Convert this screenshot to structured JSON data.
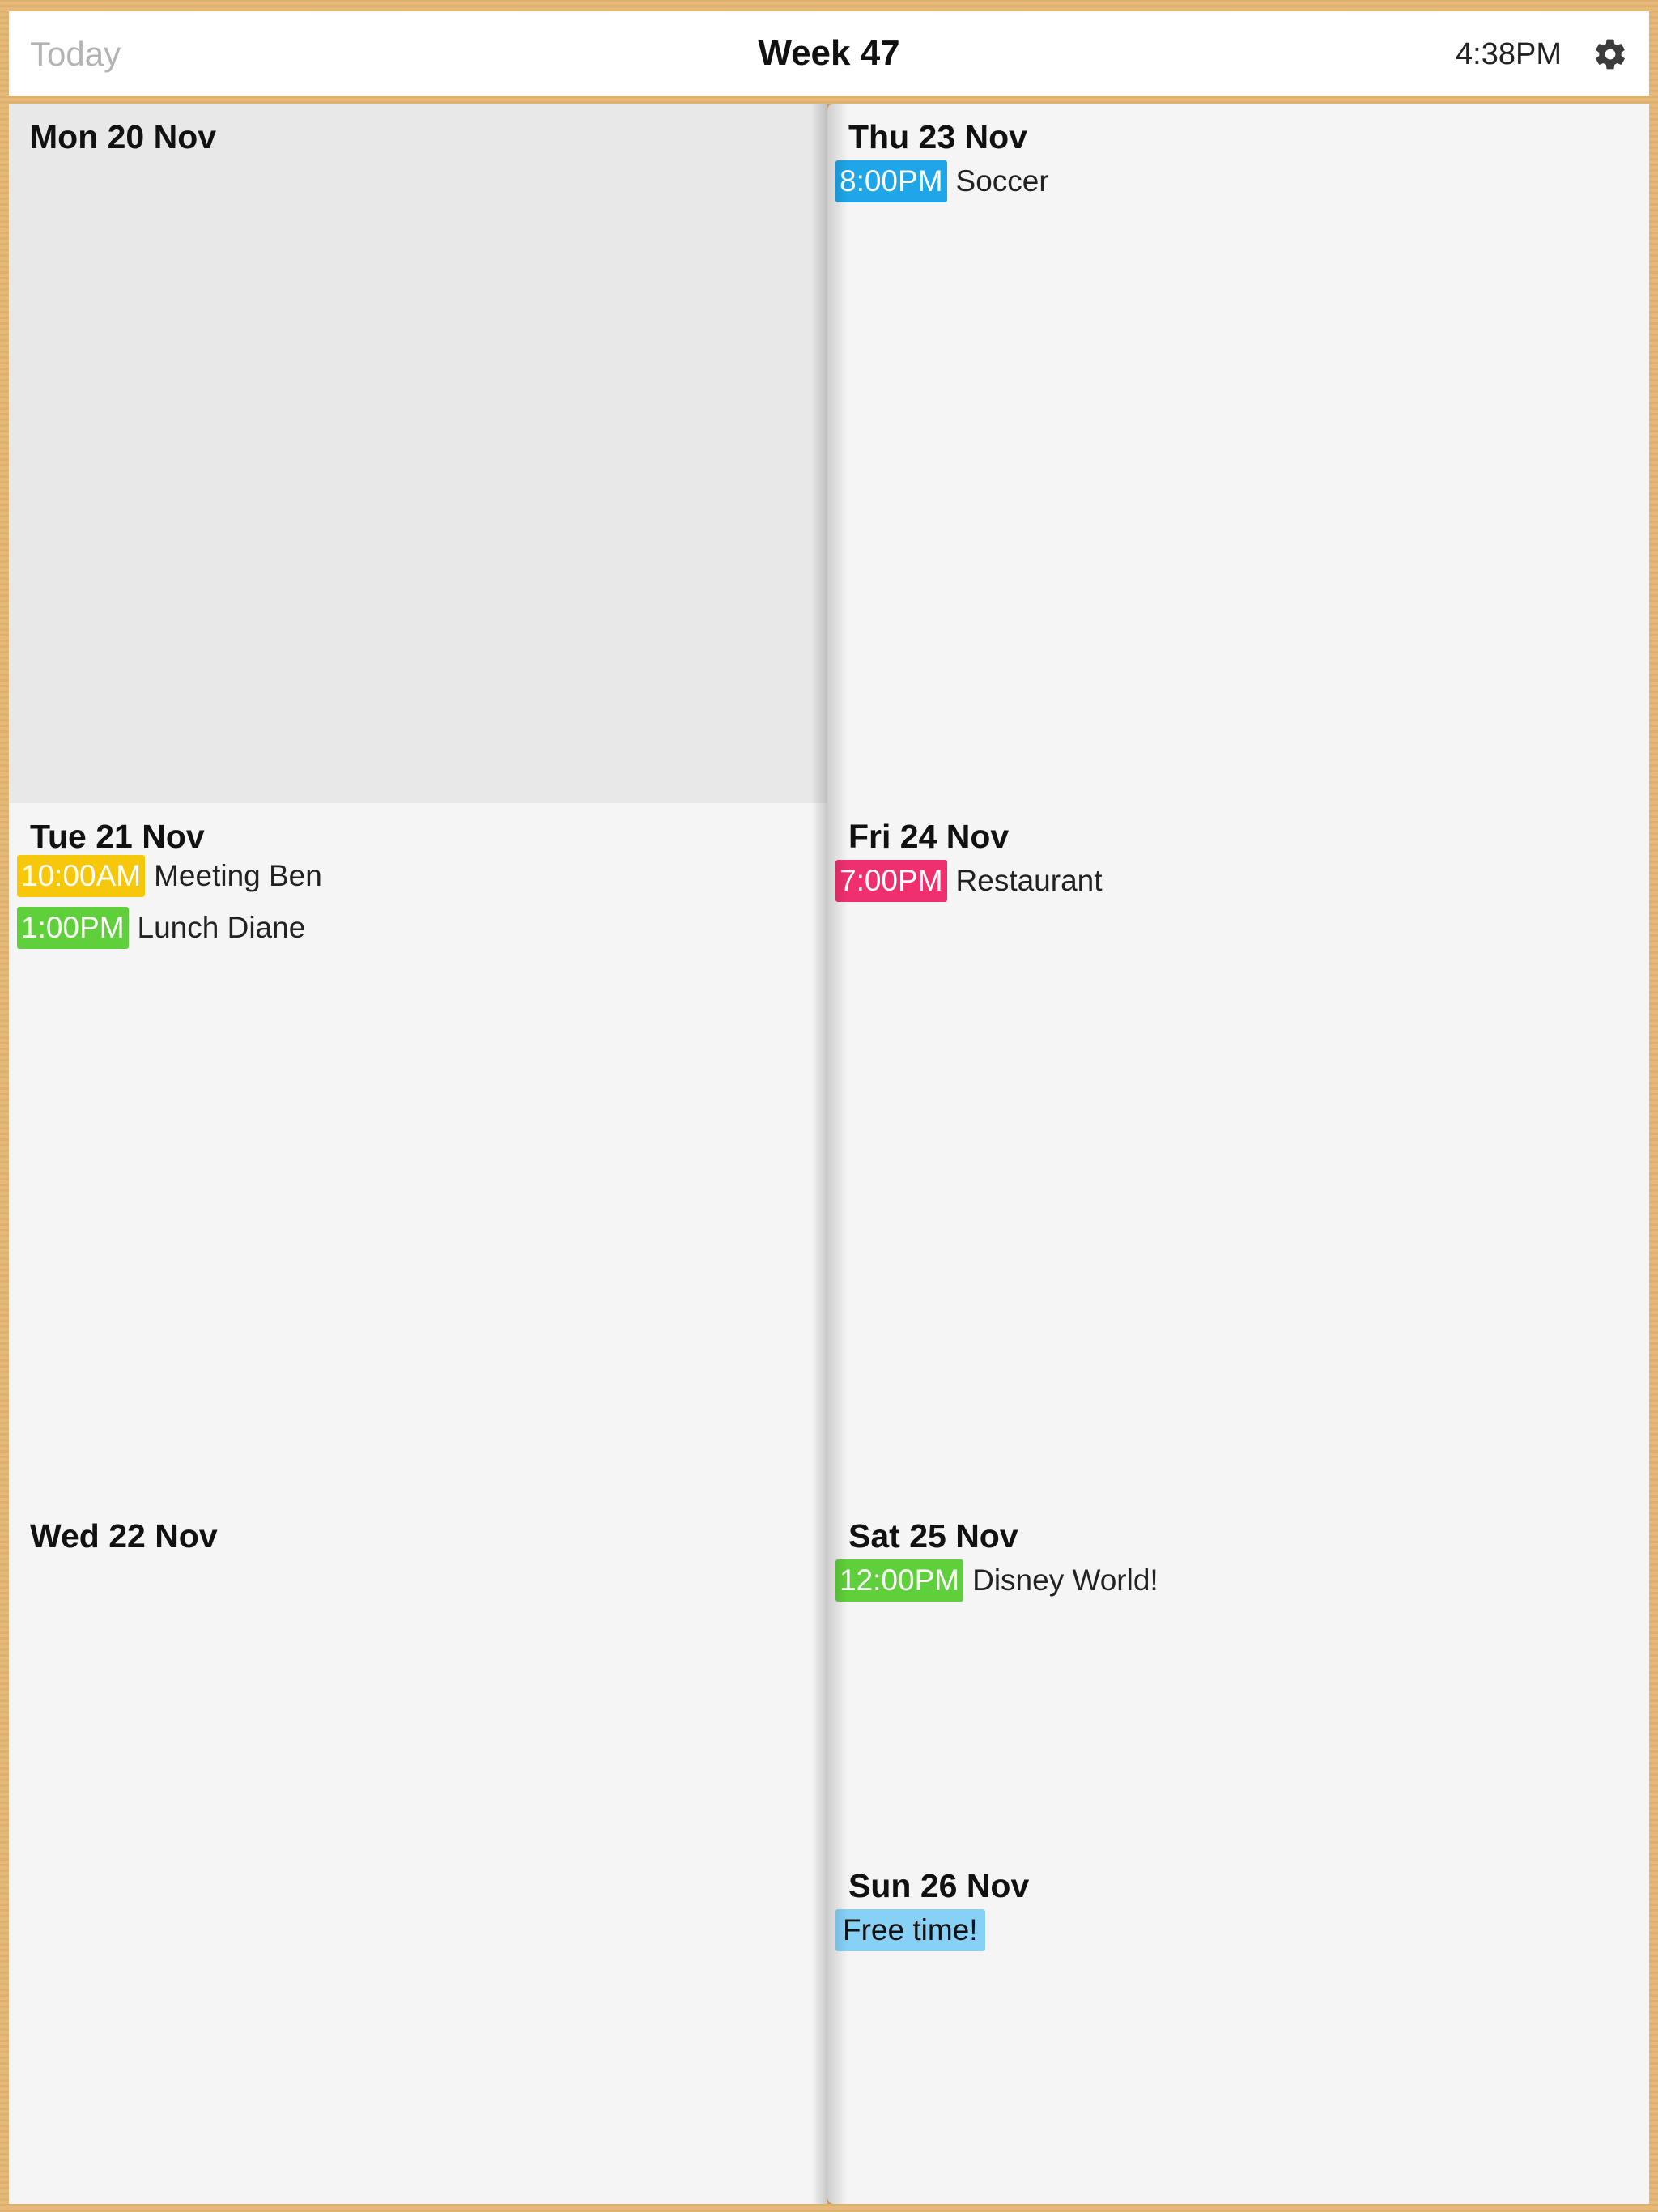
{
  "header": {
    "today_label": "Today",
    "week_title": "Week 47",
    "time": "4:38PM",
    "settings_icon": "gear-icon"
  },
  "colors": {
    "yellow": "#f7c709",
    "green": "#5fd03b",
    "blue": "#1ea6e8",
    "pink": "#f0306e",
    "light_blue": "#87d1f7"
  },
  "days": [
    {
      "title": "Mon 20 Nov",
      "events": []
    },
    {
      "title": "Tue 21 Nov",
      "events": [
        {
          "time": "10:00AM",
          "title": "Meeting Ben",
          "color": "#f7c709"
        },
        {
          "time": "1:00PM",
          "title": "Lunch Diane",
          "color": "#5fd03b"
        }
      ]
    },
    {
      "title": "Wed 22 Nov",
      "events": []
    },
    {
      "title": "Thu 23 Nov",
      "events": [
        {
          "time": "8:00PM",
          "title": "Soccer",
          "color": "#1ea6e8"
        }
      ]
    },
    {
      "title": "Fri 24 Nov",
      "events": [
        {
          "time": "7:00PM",
          "title": "Restaurant",
          "color": "#f0306e"
        }
      ]
    },
    {
      "title": "Sat 25 Nov",
      "events": [
        {
          "time": "12:00PM",
          "title": "Disney World!",
          "color": "#5fd03b"
        }
      ]
    },
    {
      "title": "Sun 26 Nov",
      "all_day": {
        "label": "Free time!",
        "color": "#87d1f7"
      }
    }
  ]
}
